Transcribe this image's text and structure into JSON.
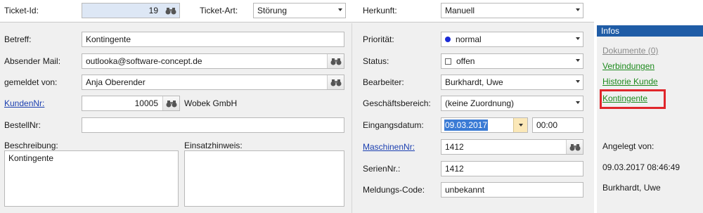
{
  "top": {
    "ticket_id_label": "Ticket-Id:",
    "ticket_id_value": "19",
    "ticket_art_label": "Ticket-Art:",
    "ticket_art_value": "Störung",
    "herkunft_label": "Herkunft:",
    "herkunft_value": "Manuell"
  },
  "left": {
    "betreff_label": "Betreff:",
    "betreff_value": "Kontingente",
    "absender_label": "Absender Mail:",
    "absender_value": "outlooka@software-concept.de",
    "gemeldet_label": "gemeldet von:",
    "gemeldet_value": "Anja Oberender",
    "kundennr_label": "KundenNr:",
    "kundennr_value": "10005",
    "kunde_name": "Wobek GmbH",
    "bestellnr_label": "BestellNr:",
    "bestellnr_value": "",
    "beschreibung_label": "Beschreibung:",
    "beschreibung_value": "Kontingente",
    "einsatz_label": "Einsatzhinweis:",
    "einsatz_value": ""
  },
  "middle": {
    "prioritaet_label": "Priorität:",
    "prioritaet_value": "normal",
    "status_label": "Status:",
    "status_value": "offen",
    "bearbeiter_label": "Bearbeiter:",
    "bearbeiter_value": "Burkhardt, Uwe",
    "geschaeft_label": "Geschäftsbereich:",
    "geschaeft_value": "(keine Zuordnung)",
    "eingang_label": "Eingangsdatum:",
    "eingang_date": "09.03.2017",
    "eingang_time": "00:00",
    "maschinen_label": "MaschinenNr:",
    "maschinen_value": "1412",
    "serien_label": "SerienNr.:",
    "serien_value": "1412",
    "meldung_label": "Meldungs-Code:",
    "meldung_value": "unbekannt"
  },
  "infos": {
    "header": "Infos",
    "dokumente": "Dokumente (0)",
    "verbindungen": "Verbindungen",
    "historie": "Historie Kunde",
    "kontingente": "Kontingente",
    "angelegt_label": "Angelegt von:",
    "angelegt_datum": "09.03.2017 08:46:49",
    "angelegt_user": "Burkhardt, Uwe"
  },
  "colors": {
    "link": "#1b3fb0",
    "info_link": "#1d8a1d",
    "highlight": "#e0262b",
    "header_bg": "#1f5ca6",
    "selection": "#3a7bd5"
  }
}
